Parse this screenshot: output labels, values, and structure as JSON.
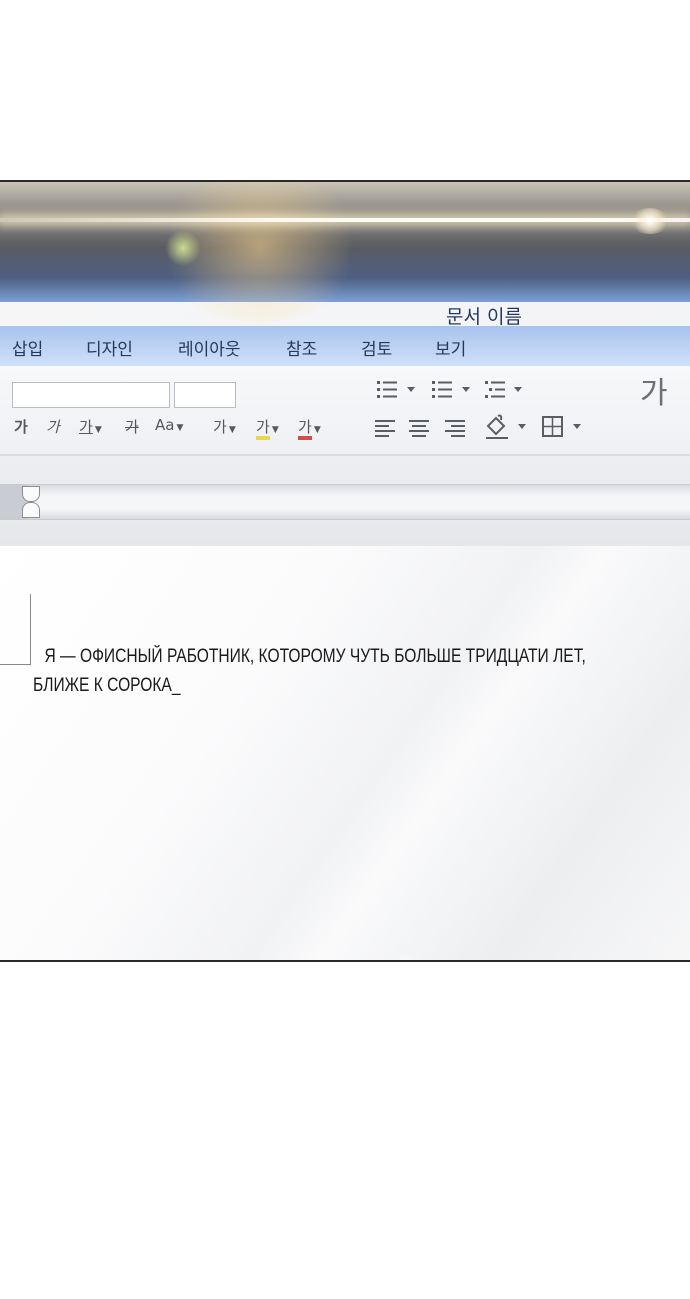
{
  "window": {
    "document_title": "문서 이름"
  },
  "tabs": [
    {
      "label": "삽입"
    },
    {
      "label": "디자인"
    },
    {
      "label": "레이아웃"
    },
    {
      "label": "참조"
    },
    {
      "label": "검토"
    },
    {
      "label": "보기"
    }
  ],
  "ribbon": {
    "font_name_value": "",
    "font_size_value": "",
    "format_buttons": [
      {
        "label": "가",
        "icon": "bold-icon"
      },
      {
        "label": "가",
        "icon": "italic-icon"
      },
      {
        "label": "가",
        "icon": "underline-icon"
      },
      {
        "label": "가",
        "icon": "strikethrough-icon"
      },
      {
        "label": "Aa",
        "icon": "change-case-icon"
      },
      {
        "label": "가",
        "icon": "text-effects-icon"
      },
      {
        "label": "가",
        "icon": "highlight-icon"
      },
      {
        "label": "가",
        "icon": "font-color-icon"
      }
    ],
    "styles_label": "가",
    "highlight_color": "#e9d84a",
    "font_color": "#d64a4a"
  },
  "document": {
    "lines": [
      "Я — ОФИСНЫЙ РАБОТНИК, КОТОРОМУ ЧУТЬ БОЛЬШЕ ТРИДЦАТИ ЛЕТ,",
      "БЛИЖЕ К СОРОКА_"
    ]
  },
  "colors": {
    "tab_band": "#bcd2f4",
    "title_text": "#233a60",
    "ribbon_bg": "#f3f4f6"
  }
}
